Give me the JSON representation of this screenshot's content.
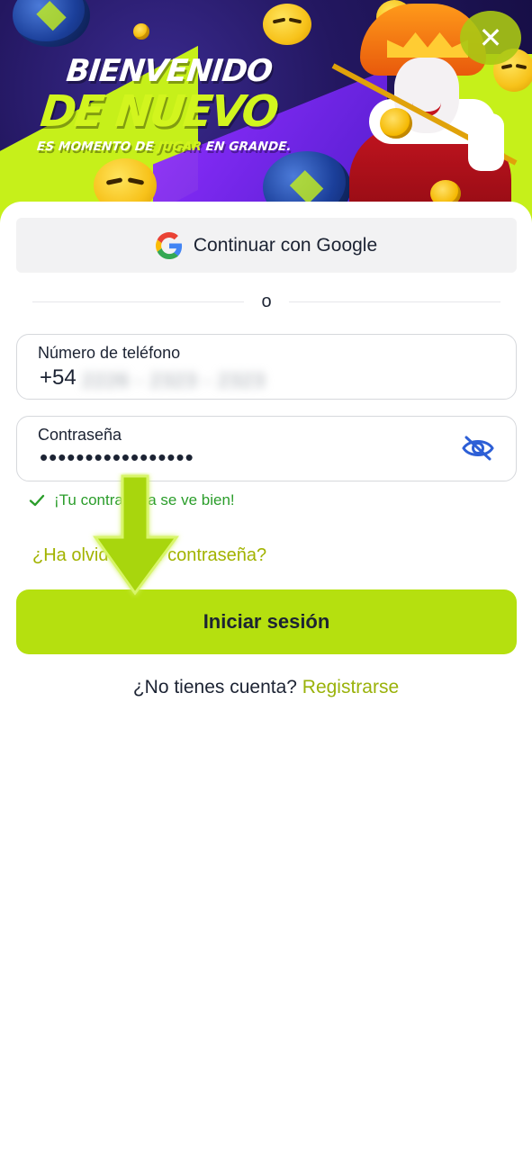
{
  "banner": {
    "title_line1": "BIENVENIDO",
    "title_line2": "DE NUEVO",
    "tagline_before": "ES MOMENTO DE ",
    "tagline_accent": "JUGAR",
    "tagline_after": " EN GRANDE.",
    "close_icon": "close-icon"
  },
  "login": {
    "google_label": "Continuar con Google",
    "divider_text": "o",
    "phone_label": "Número de teléfono",
    "phone_prefix": "+54",
    "phone_number_obscured": "2226 - 2323 - 2323",
    "password_label": "Contraseña",
    "password_masked": "•••••••••••••••••",
    "password_hint": "¡Tu contraseña se ve bien!",
    "forgot_password": "¿Ha olvidado su contraseña?",
    "submit_label": "Iniciar sesión",
    "no_account_text": "¿No tienes cuenta? ",
    "register_link": "Registrarse"
  },
  "colors": {
    "accent_lime": "#b5e00f",
    "link_lime": "#9ab20a",
    "success_green": "#2a9d2a",
    "eye_icon_blue": "#2d5fd6",
    "banner_purple": "#231760"
  },
  "icons": [
    "google-icon",
    "eye-slash-icon",
    "check-icon",
    "close-icon",
    "arrow-down-icon"
  ]
}
